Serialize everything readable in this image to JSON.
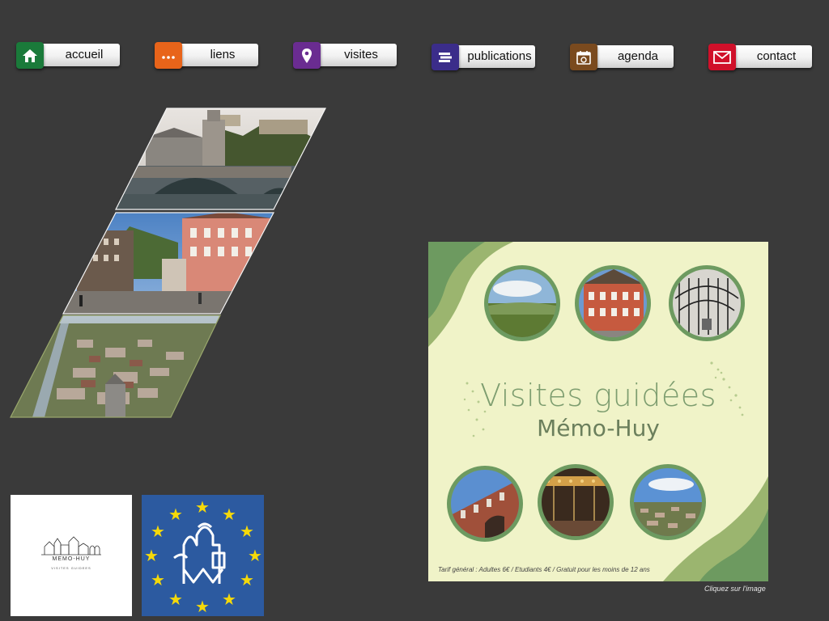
{
  "nav": [
    {
      "label": "accueil",
      "icon": "home-icon",
      "color": "#1a7a3a"
    },
    {
      "label": "liens",
      "icon": "dots-icon",
      "color": "#e8641a"
    },
    {
      "label": "visites",
      "icon": "map-pin-icon",
      "color": "#6a2c91"
    },
    {
      "label": "publications",
      "icon": "books-icon",
      "color": "#3b2d8a"
    },
    {
      "label": "agenda",
      "icon": "calendar-icon",
      "color": "#7a4a1e"
    },
    {
      "label": "contact",
      "icon": "envelope-icon",
      "color": "#d0102a"
    }
  ],
  "poster": {
    "title": "Visites guidées",
    "subtitle": "Mémo-Huy",
    "tarif": "Tarif général : Adultes 6€ / Etudiants 4€ / Gratuit pour les moins de 12 ans",
    "colors": {
      "background": "#f0f3c8",
      "green": "#7d9d6f",
      "dark_green": "#5e8a5a"
    }
  },
  "caption": "Cliquez sur l'image",
  "logo": {
    "name": "MEMO-HUY",
    "tagline": "VISITES GUIDEES"
  },
  "eu_flag": {
    "colors": {
      "blue": "#2c5aa0",
      "star": "#f5d90a"
    }
  }
}
